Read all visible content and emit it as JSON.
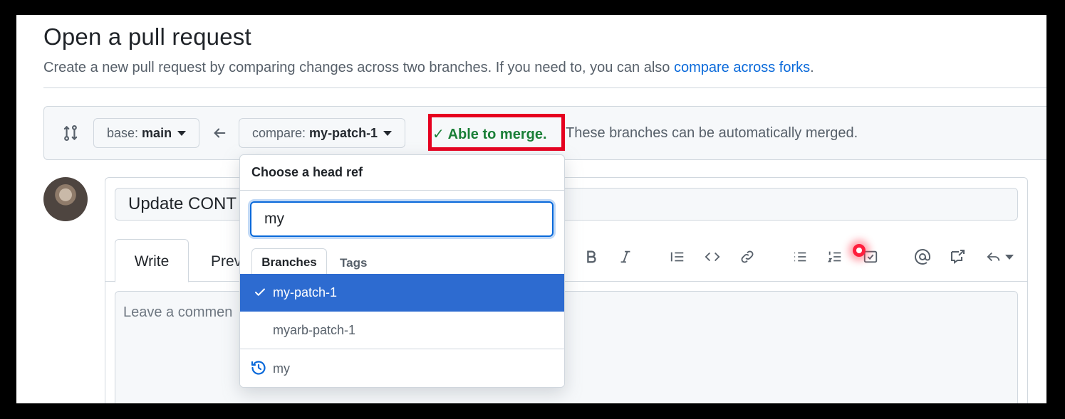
{
  "header": {
    "title": "Open a pull request",
    "subtitle_prefix": "Create a new pull request by comparing changes across two branches. If you need to, you can also ",
    "subtitle_link": "compare across forks",
    "subtitle_suffix": "."
  },
  "compare_bar": {
    "base_prefix": "base:",
    "base_branch": "main",
    "compare_prefix": "compare:",
    "compare_branch": "my-patch-1",
    "merge_status": "Able to merge.",
    "merge_message": "These branches can be automatically merged.",
    "colors": {
      "merge_ok": "#1a7f37",
      "highlight_box": "#e6001f"
    }
  },
  "pr_form": {
    "title_value": "Update CONT",
    "tabs": [
      "Write",
      "Prev"
    ],
    "comment_placeholder": "Leave a commen",
    "toolbar_icons": [
      "bold-icon",
      "italic-icon",
      "quote-icon",
      "code-icon",
      "link-icon",
      "unordered-list-icon",
      "ordered-list-icon",
      "task-list-icon",
      "mention-icon",
      "cross-reference-icon",
      "reply-icon"
    ]
  },
  "dropdown": {
    "title": "Choose a head ref",
    "filter_value": "my",
    "tabs": [
      "Branches",
      "Tags"
    ],
    "items": [
      "my-patch-1",
      "myarb-patch-1"
    ],
    "selected_index": 0,
    "footer_recent": "my",
    "colors": {
      "selected_bg": "#2d6bd0"
    }
  }
}
